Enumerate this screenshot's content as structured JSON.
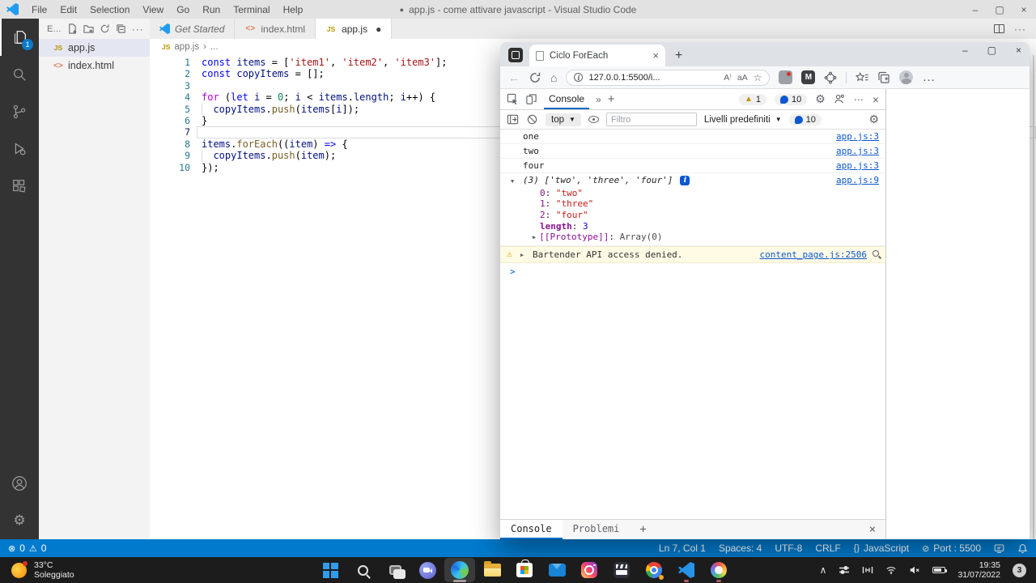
{
  "vscode": {
    "menus": [
      "File",
      "Edit",
      "Selection",
      "View",
      "Go",
      "Run",
      "Terminal",
      "Help"
    ],
    "title_dot": "●",
    "title": "app.js - come attivare javascript - Visual Studio Code",
    "window_controls": {
      "minimize": "–",
      "restore": "▢",
      "close": "×"
    },
    "explorer": {
      "header": "E...",
      "files": [
        {
          "name": "app.js",
          "icon": "js",
          "icon_text": "JS",
          "selected": true
        },
        {
          "name": "index.html",
          "icon": "html",
          "icon_text": "<>",
          "selected": false
        }
      ]
    },
    "tabs": [
      {
        "label": "Get Started",
        "icon": "vscode",
        "preview": true,
        "active": false,
        "dirty": false
      },
      {
        "label": "index.html",
        "icon": "html",
        "icon_text": "<>",
        "active": false,
        "dirty": false
      },
      {
        "label": "app.js",
        "icon": "js",
        "icon_text": "JS",
        "active": true,
        "dirty": true
      }
    ],
    "breadcrumb": {
      "icon_text": "JS",
      "file": "app.js",
      "sep": "›",
      "rest": "..."
    },
    "code_lines": [
      {
        "n": "1",
        "seg": [
          [
            "const ",
            "kw"
          ],
          [
            "items",
            "var"
          ],
          [
            " = [",
            "pun"
          ],
          [
            "'item1'",
            "str"
          ],
          [
            ", ",
            "pun"
          ],
          [
            "'item2'",
            "str"
          ],
          [
            ", ",
            "pun"
          ],
          [
            "'item3'",
            "str"
          ],
          [
            "];",
            "pun"
          ]
        ]
      },
      {
        "n": "2",
        "seg": [
          [
            "const ",
            "kw"
          ],
          [
            "copyItems",
            "var"
          ],
          [
            " = [];",
            "pun"
          ]
        ]
      },
      {
        "n": "3",
        "seg": []
      },
      {
        "n": "4",
        "seg": [
          [
            "for",
            "ctrl"
          ],
          [
            " (",
            "pun"
          ],
          [
            "let",
            "kw"
          ],
          [
            " ",
            "pun"
          ],
          [
            "i",
            "var"
          ],
          [
            " = ",
            "pun"
          ],
          [
            "0",
            "num"
          ],
          [
            "; ",
            "pun"
          ],
          [
            "i",
            "var"
          ],
          [
            " < ",
            "pun"
          ],
          [
            "items",
            "var"
          ],
          [
            ".",
            "pun"
          ],
          [
            "length",
            "var"
          ],
          [
            "; ",
            "pun"
          ],
          [
            "i",
            "var"
          ],
          [
            "++) {",
            "pun"
          ]
        ]
      },
      {
        "n": "5",
        "guide": true,
        "seg": [
          [
            "  ",
            "pun"
          ],
          [
            "copyItems",
            "var"
          ],
          [
            ".",
            "pun"
          ],
          [
            "push",
            "fn"
          ],
          [
            "(",
            "pun"
          ],
          [
            "items",
            "var"
          ],
          [
            "[",
            "pun"
          ],
          [
            "i",
            "var"
          ],
          [
            "]);",
            "pun"
          ]
        ]
      },
      {
        "n": "6",
        "seg": [
          [
            "}",
            "pun"
          ]
        ]
      },
      {
        "n": "7",
        "current": true,
        "seg": []
      },
      {
        "n": "8",
        "seg": [
          [
            "items",
            "var"
          ],
          [
            ".",
            "pun"
          ],
          [
            "forEach",
            "fn"
          ],
          [
            "((",
            "pun"
          ],
          [
            "item",
            "var"
          ],
          [
            ") ",
            "pun"
          ],
          [
            "=>",
            "kw"
          ],
          [
            " {",
            "pun"
          ]
        ]
      },
      {
        "n": "9",
        "guide": true,
        "seg": [
          [
            "  ",
            "pun"
          ],
          [
            "copyItems",
            "var"
          ],
          [
            ".",
            "pun"
          ],
          [
            "push",
            "fn"
          ],
          [
            "(",
            "pun"
          ],
          [
            "item",
            "var"
          ],
          [
            ");",
            "pun"
          ]
        ]
      },
      {
        "n": "10",
        "seg": [
          [
            "});",
            "pun"
          ]
        ]
      }
    ],
    "status": {
      "errors": "0",
      "warnings": "0",
      "right_items": [
        {
          "label": "Ln 7, Col 1"
        },
        {
          "label": "Spaces: 4"
        },
        {
          "label": "UTF-8"
        },
        {
          "label": "CRLF"
        },
        {
          "label": "JavaScript",
          "icon": "{}"
        },
        {
          "label": "Port : 5500",
          "icon": "⊘"
        }
      ]
    }
  },
  "browser": {
    "tab_title": "Ciclo ForEach",
    "url": "127.0.0.1:5500/i...",
    "window_controls": {
      "minimize": "–",
      "maximize": "▢",
      "close": "×"
    },
    "devtools": {
      "top_tab": "Console",
      "warn_count": "1",
      "msg_count": "10",
      "context": "top",
      "filter_placeholder": "Filtro",
      "levels_label": "Livelli predefiniti",
      "msg_count2": "10",
      "entries": [
        {
          "type": "log",
          "text": "one",
          "source": "app.js:3"
        },
        {
          "type": "log",
          "text": "two",
          "source": "app.js:3"
        },
        {
          "type": "log",
          "text": "four",
          "source": "app.js:3"
        },
        {
          "type": "array",
          "preview": "(3) ['two', 'three', 'four']",
          "badge": "i",
          "source": "app.js:9",
          "props": [
            {
              "k": "0",
              "v": "\"two\"",
              "t": "str"
            },
            {
              "k": "1",
              "v": "\"three\"",
              "t": "str"
            },
            {
              "k": "2",
              "v": "\"four\"",
              "t": "str"
            },
            {
              "k": "length",
              "v": "3",
              "t": "num",
              "bold": true
            },
            {
              "k": "[[Prototype]]",
              "v": "Array(0)",
              "t": "obj",
              "arrow": true
            }
          ]
        },
        {
          "type": "warn",
          "text": "Bartender API access denied.",
          "source": "content_page.js:2506"
        },
        {
          "type": "prompt"
        }
      ],
      "drawer": {
        "console": "Console",
        "problems": "Problemi"
      }
    }
  },
  "taskbar": {
    "weather": {
      "temp": "33°C",
      "condition": "Soleggiato"
    },
    "apps": [
      {
        "name": "start"
      },
      {
        "name": "search"
      },
      {
        "name": "taskview"
      },
      {
        "name": "chat"
      },
      {
        "name": "edge",
        "active": true
      },
      {
        "name": "explorer"
      },
      {
        "name": "store"
      },
      {
        "name": "mail"
      },
      {
        "name": "instagram"
      },
      {
        "name": "clipchamp"
      },
      {
        "name": "chrome",
        "badge": true
      },
      {
        "name": "vscode",
        "running": true
      },
      {
        "name": "paint",
        "running": true
      }
    ],
    "clock": {
      "time": "19:35",
      "date": "31/07/2022"
    },
    "notif_badge": "3"
  }
}
